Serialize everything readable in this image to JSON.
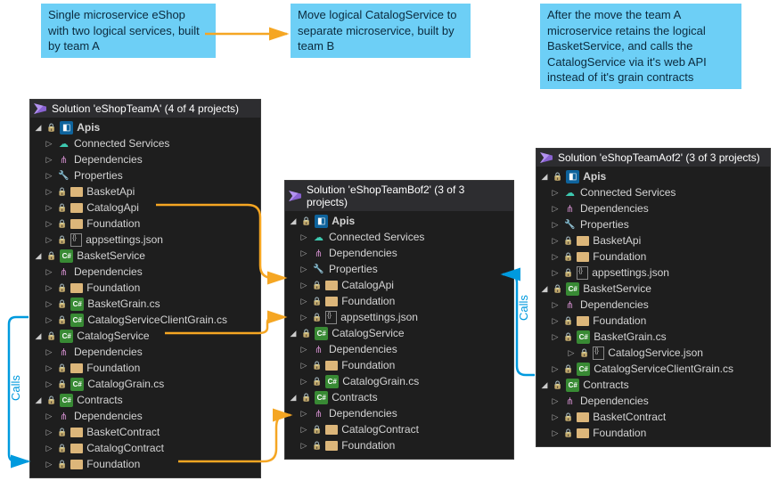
{
  "annotations": {
    "left": "Single microservice eShop with two logical services, built by team A",
    "mid": "Move logical CatalogService to separate microservice, built by team B",
    "right": "After the move the team A microservice retains the logical BasketService, and calls the CatalogService via it's web API instead of it's grain contracts"
  },
  "calls_label": "Calls",
  "solutions": {
    "A": {
      "header": "Solution 'eShopTeamA' (4 of 4 projects)",
      "nodes": [
        {
          "d": 0,
          "chev": "open",
          "lock": true,
          "icon": "proj",
          "label": "Apis",
          "bold": true
        },
        {
          "d": 1,
          "chev": "closed",
          "icon": "conn",
          "label": "Connected Services"
        },
        {
          "d": 1,
          "chev": "closed",
          "icon": "dep",
          "label": "Dependencies"
        },
        {
          "d": 1,
          "chev": "closed",
          "icon": "wrench",
          "label": "Properties"
        },
        {
          "d": 1,
          "chev": "closed",
          "lock": true,
          "icon": "folder",
          "label": "BasketApi"
        },
        {
          "d": 1,
          "chev": "closed",
          "lock": true,
          "icon": "folder",
          "label": "CatalogApi"
        },
        {
          "d": 1,
          "chev": "closed",
          "lock": true,
          "icon": "folder",
          "label": "Foundation"
        },
        {
          "d": 1,
          "chev": "closed",
          "lock": true,
          "icon": "json",
          "label": "appsettings.json"
        },
        {
          "d": 0,
          "chev": "open",
          "lock": true,
          "icon": "cs",
          "label": "BasketService"
        },
        {
          "d": 1,
          "chev": "closed",
          "icon": "dep",
          "label": "Dependencies"
        },
        {
          "d": 1,
          "chev": "closed",
          "lock": true,
          "icon": "folder",
          "label": "Foundation"
        },
        {
          "d": 1,
          "chev": "closed",
          "lock": true,
          "icon": "cs",
          "label": "BasketGrain.cs"
        },
        {
          "d": 1,
          "chev": "closed",
          "lock": true,
          "icon": "cs",
          "label": "CatalogServiceClientGrain.cs"
        },
        {
          "d": 0,
          "chev": "open",
          "lock": true,
          "icon": "cs",
          "label": "CatalogService"
        },
        {
          "d": 1,
          "chev": "closed",
          "icon": "dep",
          "label": "Dependencies"
        },
        {
          "d": 1,
          "chev": "closed",
          "lock": true,
          "icon": "folder",
          "label": "Foundation"
        },
        {
          "d": 1,
          "chev": "closed",
          "lock": true,
          "icon": "cs",
          "label": "CatalogGrain.cs"
        },
        {
          "d": 0,
          "chev": "open",
          "lock": true,
          "icon": "cs",
          "label": "Contracts"
        },
        {
          "d": 1,
          "chev": "closed",
          "icon": "dep",
          "label": "Dependencies"
        },
        {
          "d": 1,
          "chev": "closed",
          "lock": true,
          "icon": "folder",
          "label": "BasketContract"
        },
        {
          "d": 1,
          "chev": "closed",
          "lock": true,
          "icon": "folder",
          "label": "CatalogContract"
        },
        {
          "d": 1,
          "chev": "closed",
          "lock": true,
          "icon": "folder",
          "label": "Foundation"
        }
      ]
    },
    "B": {
      "header": "Solution 'eShopTeamBof2' (3 of 3 projects)",
      "nodes": [
        {
          "d": 0,
          "chev": "open",
          "lock": true,
          "icon": "proj",
          "label": "Apis",
          "bold": true
        },
        {
          "d": 1,
          "chev": "closed",
          "icon": "conn",
          "label": "Connected Services"
        },
        {
          "d": 1,
          "chev": "closed",
          "icon": "dep",
          "label": "Dependencies"
        },
        {
          "d": 1,
          "chev": "closed",
          "icon": "wrench",
          "label": "Properties"
        },
        {
          "d": 1,
          "chev": "closed",
          "lock": true,
          "icon": "folder",
          "label": "CatalogApi"
        },
        {
          "d": 1,
          "chev": "closed",
          "lock": true,
          "icon": "folder",
          "label": "Foundation"
        },
        {
          "d": 1,
          "chev": "closed",
          "lock": true,
          "icon": "json",
          "label": "appsettings.json"
        },
        {
          "d": 0,
          "chev": "open",
          "lock": true,
          "icon": "cs",
          "label": "CatalogService"
        },
        {
          "d": 1,
          "chev": "closed",
          "icon": "dep",
          "label": "Dependencies"
        },
        {
          "d": 1,
          "chev": "closed",
          "lock": true,
          "icon": "folder",
          "label": "Foundation"
        },
        {
          "d": 1,
          "chev": "closed",
          "lock": true,
          "icon": "cs",
          "label": "CatalogGrain.cs"
        },
        {
          "d": 0,
          "chev": "open",
          "lock": true,
          "icon": "cs",
          "label": "Contracts"
        },
        {
          "d": 1,
          "chev": "closed",
          "icon": "dep",
          "label": "Dependencies"
        },
        {
          "d": 1,
          "chev": "closed",
          "lock": true,
          "icon": "folder",
          "label": "CatalogContract"
        },
        {
          "d": 1,
          "chev": "closed",
          "lock": true,
          "icon": "folder",
          "label": "Foundation"
        }
      ]
    },
    "C": {
      "header": "Solution 'eShopTeamAof2' (3 of 3 projects)",
      "nodes": [
        {
          "d": 0,
          "chev": "open",
          "lock": true,
          "icon": "proj",
          "label": "Apis",
          "bold": true
        },
        {
          "d": 1,
          "chev": "closed",
          "icon": "conn",
          "label": "Connected Services"
        },
        {
          "d": 1,
          "chev": "closed",
          "icon": "dep",
          "label": "Dependencies"
        },
        {
          "d": 1,
          "chev": "closed",
          "icon": "wrench",
          "label": "Properties"
        },
        {
          "d": 1,
          "chev": "closed",
          "lock": true,
          "icon": "folder",
          "label": "BasketApi"
        },
        {
          "d": 1,
          "chev": "closed",
          "lock": true,
          "icon": "folder",
          "label": "Foundation"
        },
        {
          "d": 1,
          "chev": "closed",
          "lock": true,
          "icon": "json",
          "label": "appsettings.json"
        },
        {
          "d": 0,
          "chev": "open",
          "lock": true,
          "icon": "cs",
          "label": "BasketService"
        },
        {
          "d": 1,
          "chev": "closed",
          "icon": "dep",
          "label": "Dependencies"
        },
        {
          "d": 1,
          "chev": "closed",
          "lock": true,
          "icon": "folder",
          "label": "Foundation"
        },
        {
          "d": 1,
          "chev": "closed",
          "lock": true,
          "icon": "cs",
          "label": "BasketGrain.cs"
        },
        {
          "d": 2,
          "chev": "closed",
          "lock": true,
          "icon": "json",
          "label": "CatalogService.json"
        },
        {
          "d": 1,
          "chev": "closed",
          "lock": true,
          "icon": "cs",
          "label": "CatalogServiceClientGrain.cs"
        },
        {
          "d": 0,
          "chev": "open",
          "lock": true,
          "icon": "cs",
          "label": "Contracts"
        },
        {
          "d": 1,
          "chev": "closed",
          "icon": "dep",
          "label": "Dependencies"
        },
        {
          "d": 1,
          "chev": "closed",
          "lock": true,
          "icon": "folder",
          "label": "BasketContract"
        },
        {
          "d": 1,
          "chev": "closed",
          "lock": true,
          "icon": "folder",
          "label": "Foundation"
        }
      ]
    }
  }
}
